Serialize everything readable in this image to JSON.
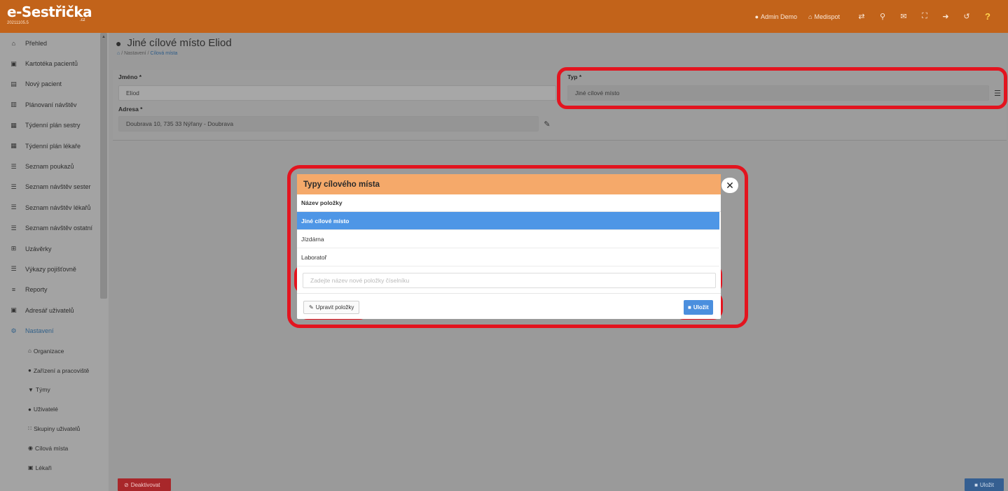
{
  "app": {
    "logo_text": "e-Sestřička",
    "logo_suffix": ".cz",
    "version": "20211105.5"
  },
  "topnav": {
    "user_label": "Admin Demo",
    "org_label": "Medispot"
  },
  "sidebar": {
    "items": [
      {
        "label": "Přehled",
        "icon": "home-icon"
      },
      {
        "label": "Kartotéka pacientů",
        "icon": "card-icon"
      },
      {
        "label": "Nový pacient",
        "icon": "id-card-icon"
      },
      {
        "label": "Plánovaní návštěv",
        "icon": "map-icon"
      },
      {
        "label": "Týdenní plán sestry",
        "icon": "calendar-icon"
      },
      {
        "label": "Týdenní plán lékaře",
        "icon": "calendar-icon"
      },
      {
        "label": "Seznam poukazů",
        "icon": "list-icon"
      },
      {
        "label": "Seznam návštěv sester",
        "icon": "list-icon"
      },
      {
        "label": "Seznam návštěv lékařů",
        "icon": "list-icon"
      },
      {
        "label": "Seznam návštěv ostatní",
        "icon": "list-icon"
      },
      {
        "label": "Uzávěrky",
        "icon": "grid-icon"
      },
      {
        "label": "Výkazy pojišťovně",
        "icon": "list-icon"
      },
      {
        "label": "Reporty",
        "icon": "chart-icon"
      },
      {
        "label": "Adresář uživatelů",
        "icon": "address-book-icon"
      },
      {
        "label": "Nastavení",
        "icon": "cogs-icon"
      }
    ],
    "subitems": [
      {
        "label": "Organizace",
        "icon": "bank-icon"
      },
      {
        "label": "Zařízení a pracoviště",
        "icon": "circle-icon"
      },
      {
        "label": "Týmy",
        "icon": "shield-icon"
      },
      {
        "label": "Uživatelé",
        "icon": "user-icon"
      },
      {
        "label": "Skupiny uživatelů",
        "icon": "users-icon"
      },
      {
        "label": "Cílová místa",
        "icon": "map-marker-icon"
      },
      {
        "label": "Lékaři",
        "icon": "medkit-icon"
      }
    ]
  },
  "page": {
    "title": "Jiné cílové místo Eliod",
    "breadcrumb": [
      "Nastavení",
      "Cílová místa"
    ]
  },
  "form": {
    "name_label": "Jméno *",
    "name_value": "Eliod",
    "type_label": "Typ *",
    "type_value": "Jiné cílové místo",
    "address_label": "Adresa *",
    "address_value": "Doubrava 10, 735 33 Nýřany - Doubrava"
  },
  "modal": {
    "title": "Typy cílového místa",
    "column_header": "Název položky",
    "items": [
      "Jiné cílové místo",
      "Jízdárna",
      "Laboratoř"
    ],
    "selected_index": 0,
    "new_item_placeholder": "Zadejte název nové položky číselníku",
    "edit_button": "Upravit položky",
    "save_button": "Uložit"
  },
  "footer": {
    "deactivate_button": "Deaktivovat",
    "save_button": "Uložit"
  },
  "colors": {
    "topbar": "#c2631a",
    "modal_header": "#f5a96a",
    "selected_row": "#4e96e6",
    "highlight": "#e3141f",
    "deactivate": "#a8272a",
    "save": "#355f91"
  }
}
